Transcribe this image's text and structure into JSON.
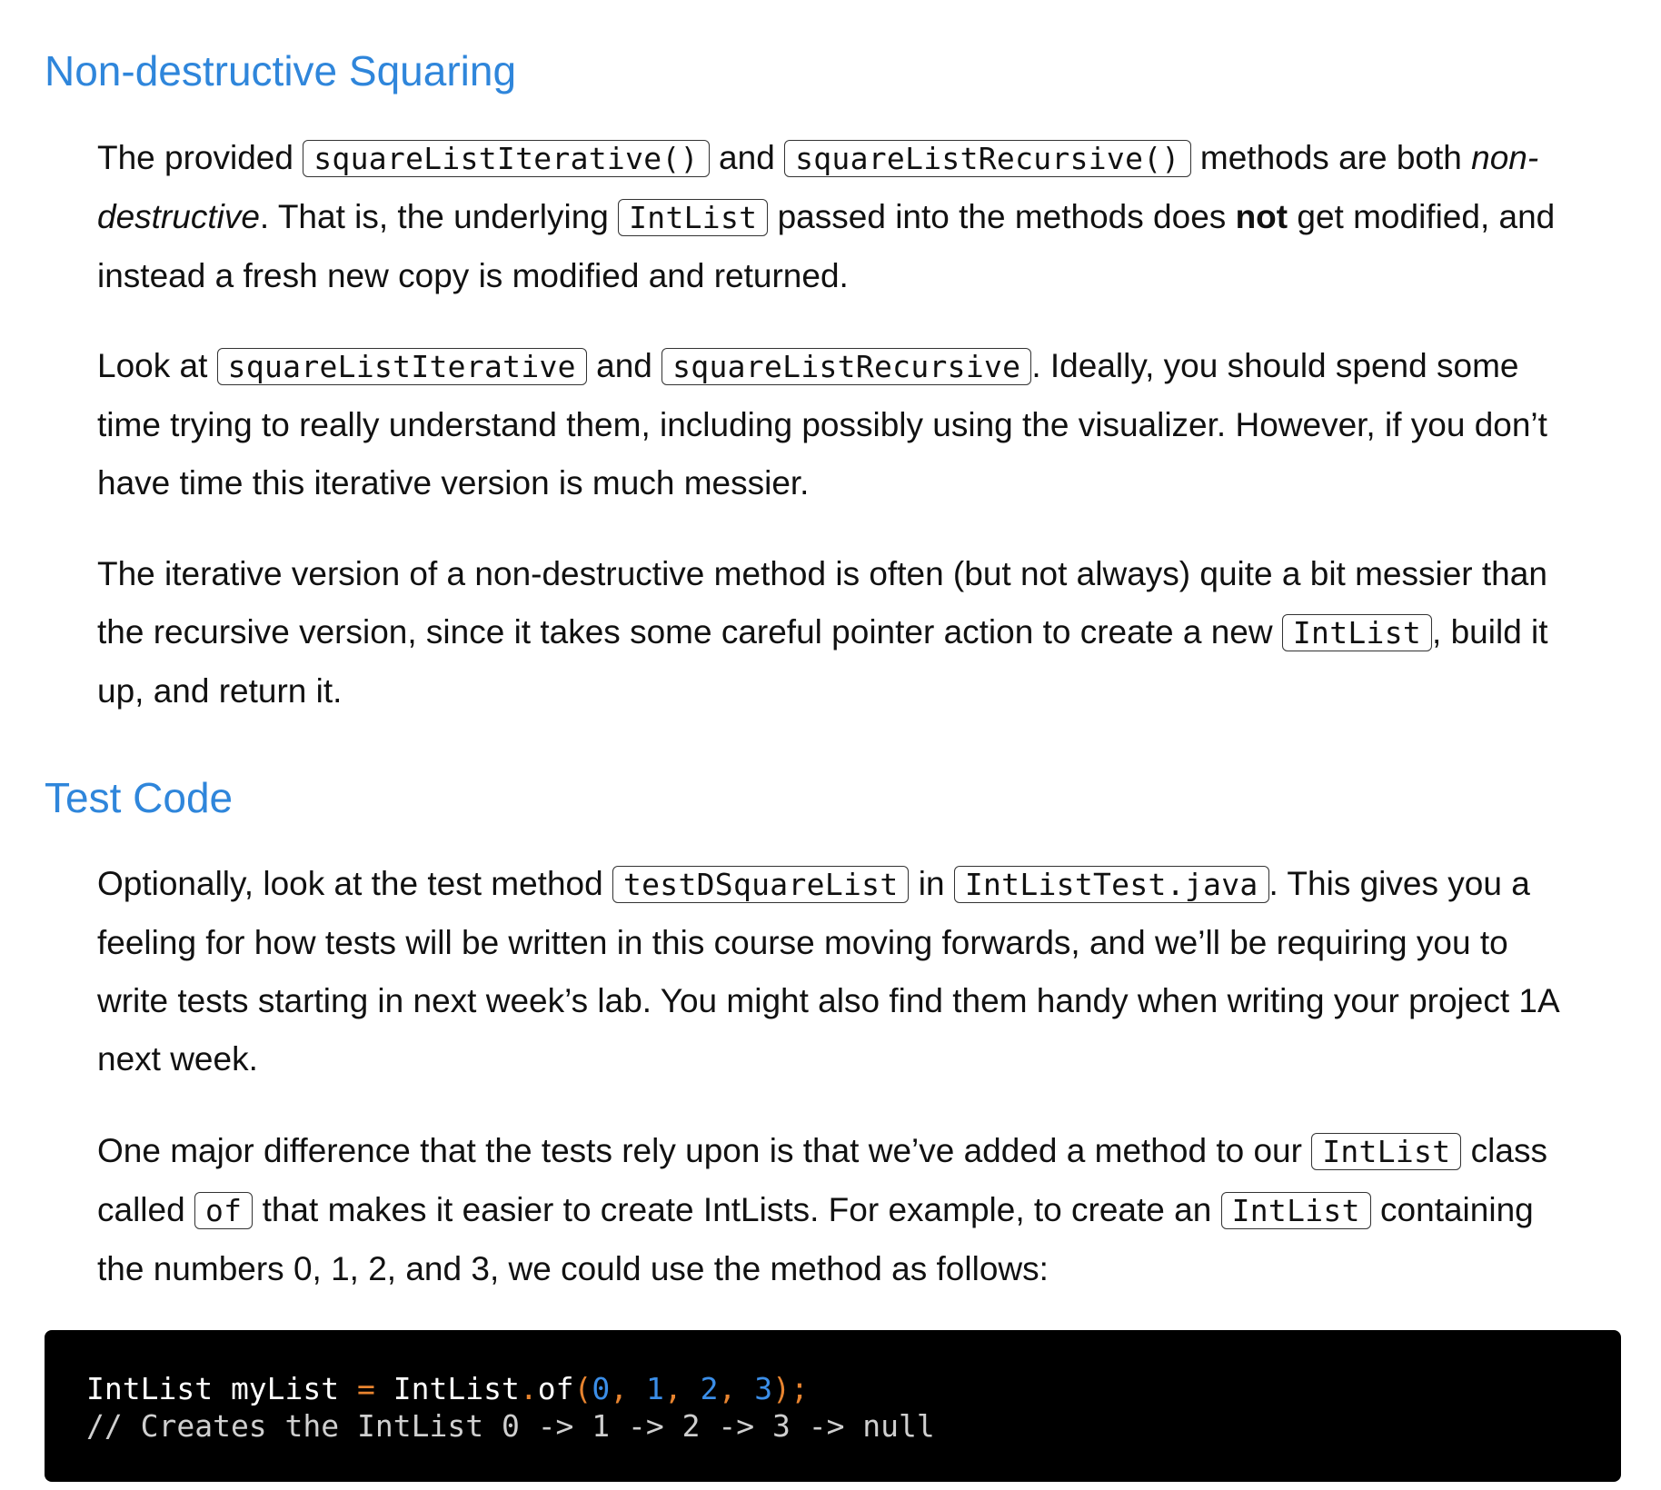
{
  "sections": [
    {
      "heading": "Non-destructive Squaring",
      "paragraphs": [
        {
          "t1": "The provided ",
          "c1": "squareListIterative()",
          "t2": " and ",
          "c2": "squareListRecursive()",
          "t3": " methods are both ",
          "em1": "non-destructive",
          "t4": ". That is, the underlying ",
          "c3": "IntList",
          "t5": " passed into the methods does ",
          "strong1": "not",
          "t6": " get modified, and instead a fresh new copy is modified and returned."
        },
        {
          "t1": "Look at ",
          "c1": "squareListIterative",
          "t2": " and ",
          "c2": "squareListRecursive",
          "t3": ". Ideally, you should spend some time trying to really understand them, including possibly using the visualizer. However, if you don’t have time this iterative version is much messier."
        },
        {
          "t1": "The iterative version of a non-destructive method is often (but not always) quite a bit messier than the recursive version, since it takes some careful pointer action to create a new ",
          "c1": "IntList",
          "t2": ", build it up, and return it."
        }
      ]
    },
    {
      "heading": "Test Code",
      "paragraphs": [
        {
          "t1": "Optionally, look at the test method ",
          "c1": "testDSquareList",
          "t2": " in ",
          "c2": "IntListTest.java",
          "t3": ". This gives you a feeling for how tests will be written in this course moving forwards, and we’ll be requiring you to write tests starting in next week’s lab. You might also find them handy when writing your project 1A next week."
        },
        {
          "t1": "One major difference that the tests rely upon is that we’ve added a method to our ",
          "c1": "IntList",
          "t2": " class called ",
          "c2": "of",
          "t3": " that makes it easier to create IntLists. For example, to create an ",
          "c3": "IntList",
          "t4": " containing the numbers 0, 1, 2, and 3, we could use the method as follows:"
        }
      ]
    }
  ],
  "code_block": {
    "line1": {
      "a": "IntList myList ",
      "eq": "=",
      "b": " IntList",
      "dot": ".",
      "c": "of",
      "lp": "(",
      "n0": "0",
      "s1": ", ",
      "n1": "1",
      "s2": ", ",
      "n2": "2",
      "s3": ", ",
      "n3": "3",
      "end": ");"
    },
    "line2": {
      "comment": "// Creates the ",
      "rest": "IntList 0 -> 1 -> 2 -> 3 -> null"
    }
  },
  "colors": {
    "heading": "#2f86db",
    "code_background": "#000000",
    "code_operator": "#e8842f",
    "code_number": "#3b8ee8"
  }
}
